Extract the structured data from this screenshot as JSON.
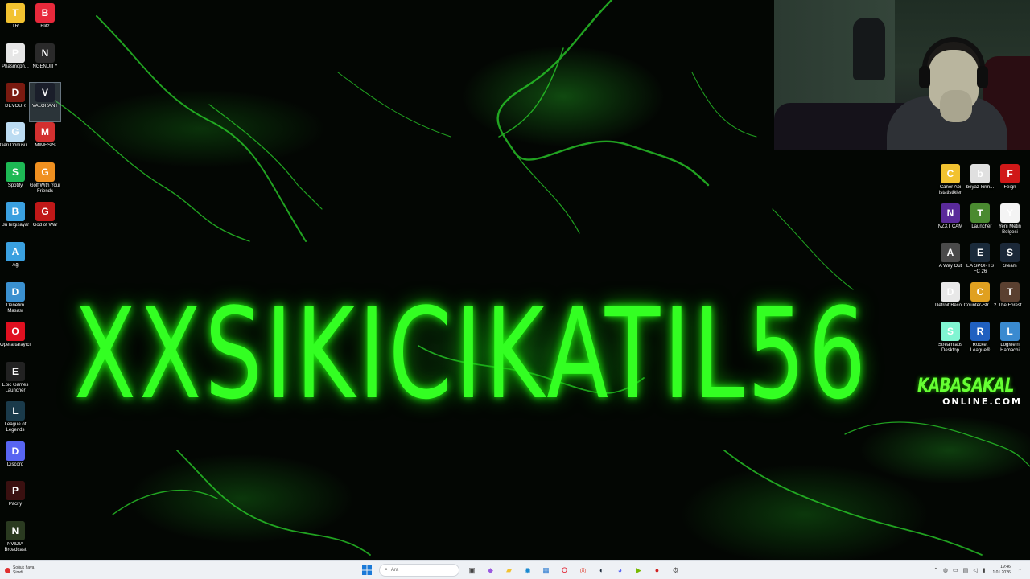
{
  "wallpaper": {
    "title_text": "XXSIKICIKATIL56",
    "title_color": "#33ff22",
    "logo_top": "KABASAKAL",
    "logo_bottom": "ONLINE.COM"
  },
  "left_icons": [
    {
      "label": "TR",
      "icon": "folder-icon",
      "color": "#f2c230"
    },
    {
      "label": "Blitz",
      "icon": "blitz-icon",
      "color": "#e8293b"
    },
    {
      "label": "Phasmoph...",
      "icon": "phasmophobia-icon",
      "color": "#e6e6e6"
    },
    {
      "label": "NGENUITY",
      "icon": "ngenuity-icon",
      "color": "#2a2a2a"
    },
    {
      "label": "DEVOUR",
      "icon": "devour-icon",
      "color": "#7a1a10"
    },
    {
      "label": "VALORANT",
      "icon": "valorant-icon",
      "color": "#1a1e2a"
    },
    {
      "label": "Geri Dönüşü...",
      "icon": "recycle-bin-icon",
      "color": "#bcdcf2"
    },
    {
      "label": "MIMESIS",
      "icon": "mimesis-icon",
      "color": "#d33030"
    },
    {
      "label": "Spotify",
      "icon": "spotify-icon",
      "color": "#1db954"
    },
    {
      "label": "Golf With Your Friends",
      "icon": "golf-with-your-friends-icon",
      "color": "#f09020"
    },
    {
      "label": "Bu bilgisayar",
      "icon": "this-pc-icon",
      "color": "#3aa0e0"
    },
    {
      "label": "God of War",
      "icon": "god-of-war-icon",
      "color": "#c01818"
    },
    {
      "label": "Ağ",
      "icon": "network-icon",
      "color": "#3aa0e0"
    },
    {
      "label": "Denetim Masası",
      "icon": "control-panel-icon",
      "color": "#3a90d0"
    },
    {
      "label": "Opera tarayıcı",
      "icon": "opera-icon",
      "color": "#e01020"
    },
    {
      "label": "Epic Games Launcher",
      "icon": "epic-games-icon",
      "color": "#222222"
    },
    {
      "label": "League of Legends",
      "icon": "league-of-legends-icon",
      "color": "#1a3a4a"
    },
    {
      "label": "Discord",
      "icon": "discord-icon",
      "color": "#5865f2"
    },
    {
      "label": "Pacify",
      "icon": "pacify-icon",
      "color": "#3a1010"
    },
    {
      "label": "NVIDIA Broadcast",
      "icon": "nvidia-broadcast-icon",
      "color": "#2a3a20"
    }
  ],
  "right_icons": [
    {
      "label": "Caner Abi istatistikler",
      "icon": "folder-icon",
      "color": "#f2c230"
    },
    {
      "label": "beyaz-kirm...",
      "icon": "image-file-icon",
      "color": "#e0e0e0"
    },
    {
      "label": "Feign",
      "icon": "feign-icon",
      "color": "#d01818"
    },
    {
      "label": "NZXT CAM",
      "icon": "nzxt-cam-icon",
      "color": "#5a2a9a"
    },
    {
      "label": "TLauncher",
      "icon": "tlauncher-icon",
      "color": "#4a8a30"
    },
    {
      "label": "Yeni Metin Belgesi",
      "icon": "text-document-icon",
      "color": "#f4f4f4"
    },
    {
      "label": "A Way Out",
      "icon": "a-way-out-icon",
      "color": "#4a4a4a"
    },
    {
      "label": "EA SPORTS FC 26",
      "icon": "ea-sports-fc-icon",
      "color": "#1a2a3a"
    },
    {
      "label": "Steam",
      "icon": "steam-icon",
      "color": "#1b2838"
    },
    {
      "label": "Detroit Beco...",
      "icon": "detroit-icon",
      "color": "#e8e8e8"
    },
    {
      "label": "Counter-Str... 2",
      "icon": "counter-strike-icon",
      "color": "#e0a020"
    },
    {
      "label": "The Forest",
      "icon": "the-forest-icon",
      "color": "#5a4030"
    },
    {
      "label": "Streamlabs Desktop",
      "icon": "streamlabs-icon",
      "color": "#80f5d2"
    },
    {
      "label": "Rocket League®",
      "icon": "rocket-league-icon",
      "color": "#2060c0"
    },
    {
      "label": "LogMeIn Hamachi",
      "icon": "hamachi-icon",
      "color": "#3a8ad0"
    }
  ],
  "taskbar": {
    "weather_title": "Soğuk hava",
    "weather_subtitle": "Şimdi",
    "search_placeholder": "Ara",
    "time": "19:46",
    "date": "1.01.2026",
    "apps": [
      {
        "name": "task-view-icon",
        "glyph": "▣",
        "color": "#444444"
      },
      {
        "name": "copilot-icon",
        "glyph": "◆",
        "color": "#9a5ae0"
      },
      {
        "name": "file-explorer-icon",
        "glyph": "▰",
        "color": "#f2c230"
      },
      {
        "name": "edge-icon",
        "glyph": "◉",
        "color": "#1a8ad0"
      },
      {
        "name": "store-icon",
        "glyph": "▦",
        "color": "#2a7ad0"
      },
      {
        "name": "opera-icon",
        "glyph": "O",
        "color": "#e01020"
      },
      {
        "name": "chrome-icon",
        "glyph": "◎",
        "color": "#e04030"
      },
      {
        "name": "steam-icon",
        "glyph": "◐",
        "color": "#1b2838"
      },
      {
        "name": "discord-icon",
        "glyph": "◕",
        "color": "#5865f2"
      },
      {
        "name": "nvidia-icon",
        "glyph": "▶",
        "color": "#76b900"
      },
      {
        "name": "obs-icon",
        "glyph": "●",
        "color": "#d02020"
      },
      {
        "name": "settings-icon",
        "glyph": "⚙",
        "color": "#555555"
      }
    ]
  }
}
